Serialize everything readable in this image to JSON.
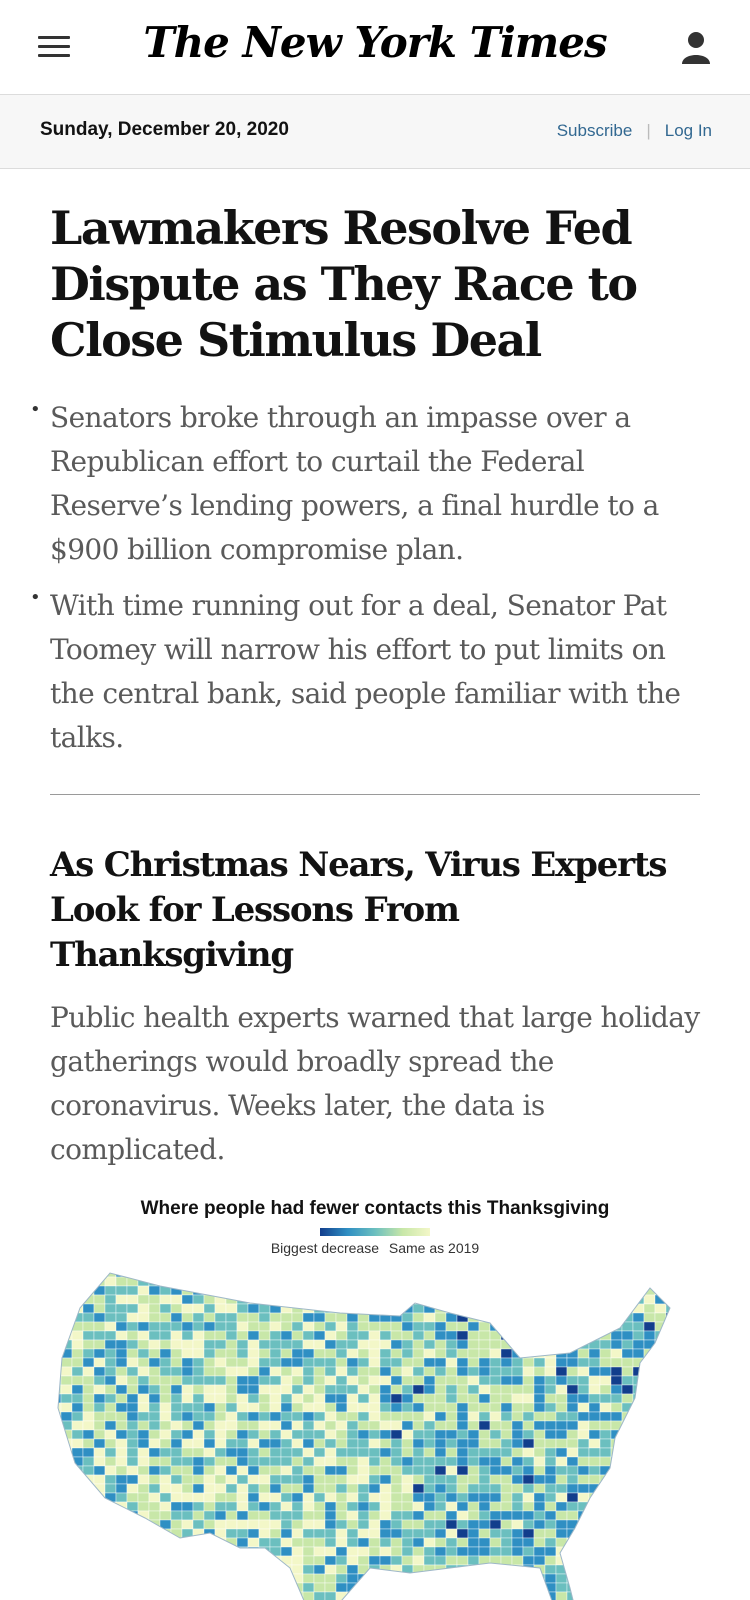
{
  "header": {
    "masthead": "The New York Times"
  },
  "datebar": {
    "date": "Sunday, December 20, 2020",
    "subscribe_label": "Subscribe",
    "login_label": "Log In"
  },
  "lead_story": {
    "headline": "Lawmakers Resolve Fed Dispute as They Race to Close Stimulus Deal",
    "bullets": [
      "Senators broke through an impasse over a Republican effort to curtail the Federal Reserve’s lending powers, a final hurdle to a $900 billion compromise plan.",
      "With time running out for a deal, Senator Pat Toomey will narrow his effort to put limits on the central bank, said people familiar with the talks."
    ]
  },
  "second_story": {
    "headline": "As Christmas Nears, Virus Experts Look for Lessons From Thanksgiving",
    "summary": "Public health experts warned that large holiday gatherings would broadly spread the coronavirus. Weeks later, the data is complicated."
  },
  "map_figure": {
    "title": "Where people had fewer contacts this Thanksgiving",
    "legend_low": "Biggest decrease",
    "legend_high": "Same as 2019",
    "colors": [
      "#123e8c",
      "#2f8fc3",
      "#6bbfbf",
      "#c8e7a8",
      "#f3f7c8"
    ]
  },
  "icons": {
    "menu": "menu-icon",
    "account": "account-icon"
  }
}
